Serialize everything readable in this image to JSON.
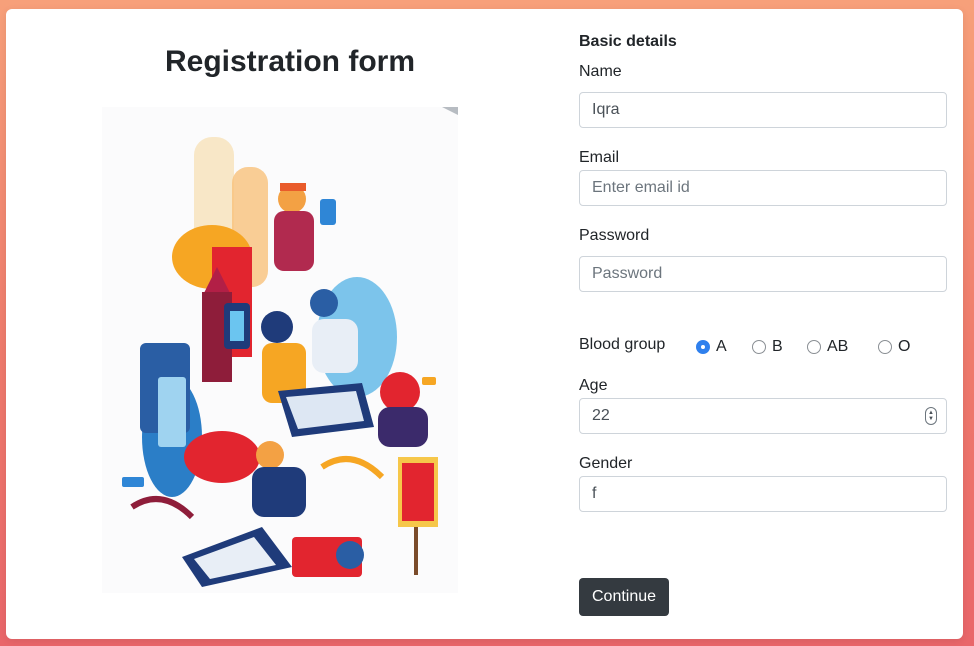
{
  "page": {
    "title": "Registration form"
  },
  "form": {
    "section_heading": "Basic details",
    "name": {
      "label": "Name",
      "value": "Iqra",
      "placeholder": ""
    },
    "email": {
      "label": "Email",
      "value": "",
      "placeholder": "Enter email id"
    },
    "password": {
      "label": "Password",
      "value": "",
      "placeholder": "Password"
    },
    "blood_group": {
      "label": "Blood group",
      "options": [
        "A",
        "B",
        "AB",
        "O"
      ],
      "selected": "A"
    },
    "age": {
      "label": "Age",
      "value": "22"
    },
    "gender": {
      "label": "Gender",
      "value": "f"
    },
    "continue_label": "Continue"
  },
  "colors": {
    "accent": "#2f80ed",
    "button": "#343a40"
  },
  "icons": {
    "illustration": "registration-illustration"
  }
}
